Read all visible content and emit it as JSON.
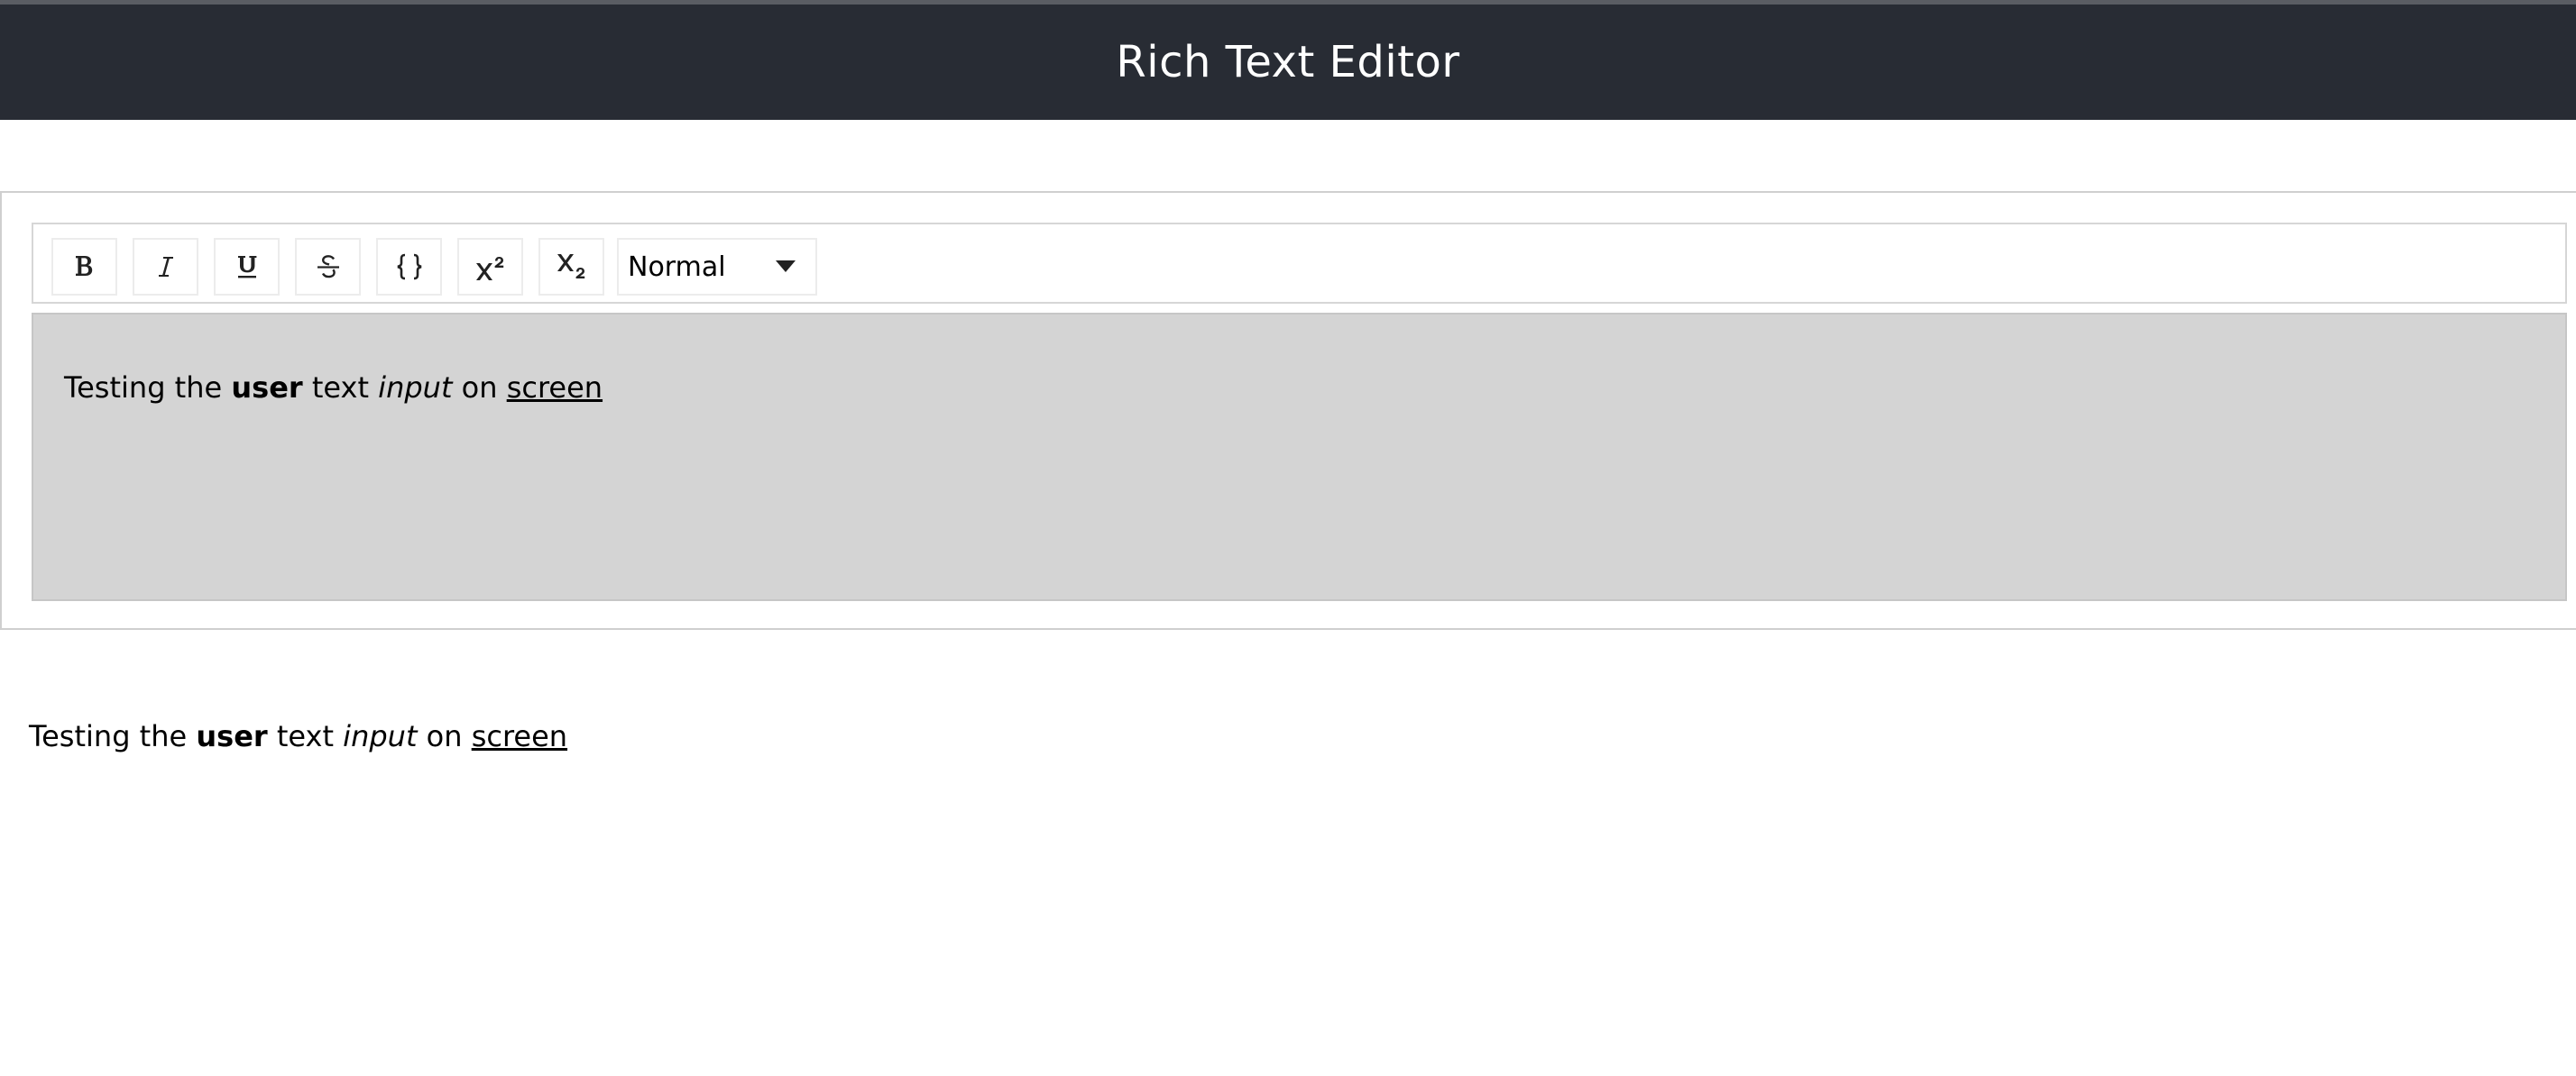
{
  "header": {
    "title": "Rich Text Editor",
    "background": "#282c34"
  },
  "toolbar": {
    "buttons": [
      {
        "name": "bold",
        "icon": "bold-icon"
      },
      {
        "name": "italic",
        "icon": "italic-icon"
      },
      {
        "name": "underline",
        "icon": "underline-icon"
      },
      {
        "name": "strikethrough",
        "icon": "strikethrough-icon"
      },
      {
        "name": "code",
        "icon": "code-braces-icon"
      },
      {
        "name": "superscript",
        "icon": "superscript-icon"
      },
      {
        "name": "subscript",
        "icon": "subscript-icon"
      }
    ],
    "block_type": {
      "selected": "Normal"
    }
  },
  "editor": {
    "background": "#d4d4d4",
    "segments": [
      {
        "text": "Testing the ",
        "style": "normal"
      },
      {
        "text": "user",
        "style": "bold"
      },
      {
        "text": " text ",
        "style": "normal"
      },
      {
        "text": "input",
        "style": "italic"
      },
      {
        "text": " on ",
        "style": "normal"
      },
      {
        "text": "screen",
        "style": "underline"
      }
    ]
  },
  "preview": {
    "segments": [
      {
        "text": "Testing the ",
        "style": "normal"
      },
      {
        "text": "user",
        "style": "bold"
      },
      {
        "text": " text ",
        "style": "normal"
      },
      {
        "text": "input",
        "style": "italic"
      },
      {
        "text": " on ",
        "style": "normal"
      },
      {
        "text": "screen",
        "style": "underline"
      }
    ]
  }
}
